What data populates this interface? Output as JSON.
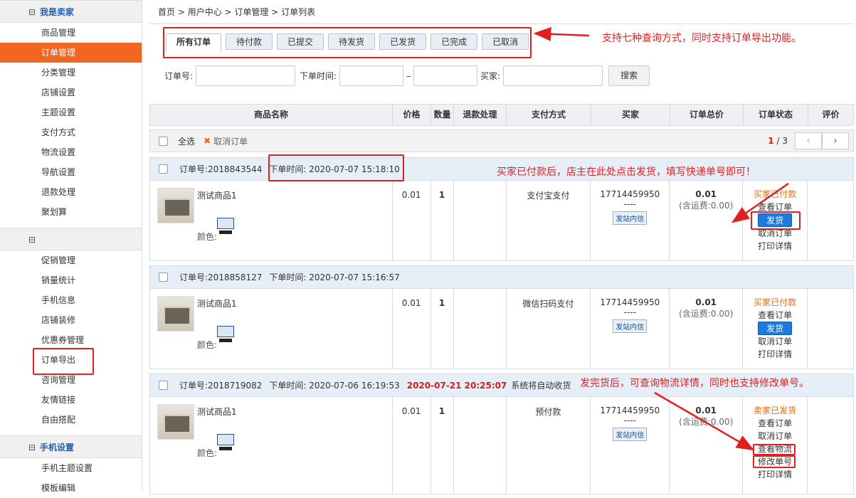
{
  "sidebar": {
    "section1": "我是卖家",
    "items1": [
      "商品管理",
      "订单管理",
      "分类管理",
      "店铺设置",
      "主题设置",
      "支付方式",
      "物流设置",
      "导航设置",
      "退款处理",
      "聚划算"
    ],
    "items2": [
      "促销管理",
      "销量统计",
      "手机信息",
      "店铺装修",
      "优惠券管理",
      "订单导出",
      "咨询管理",
      "友情链接",
      "自由搭配"
    ],
    "section3": "手机设置",
    "items3": [
      "手机主题设置",
      "模板编辑"
    ]
  },
  "breadcrumb": [
    "首页",
    "用户中心",
    "订单管理",
    "订单列表"
  ],
  "tabs": [
    "所有订单",
    "待付款",
    "已提交",
    "待发货",
    "已发货",
    "已完成",
    "已取消"
  ],
  "search": {
    "order_no_label": "订单号:",
    "time_label": "下单时间:",
    "dash": "–",
    "buyer_label": "买家:",
    "button": "搜索"
  },
  "columns": [
    "商品名称",
    "价格",
    "数量",
    "退款处理",
    "支付方式",
    "买家",
    "订单总价",
    "订单状态",
    "评价"
  ],
  "select_bar": {
    "select_all": "全选",
    "cancel_order": "取消订单",
    "page_current": "1",
    "page_sep": "/",
    "page_total": "3"
  },
  "orders": [
    {
      "no_label": "订单号:",
      "no": "2018843544",
      "time_label": "下单时间:",
      "time": "2020-07-07 15:18:10",
      "product": "测试商品1",
      "color_label": "颜色:",
      "price": "0.01",
      "qty": "1",
      "payment": "支付宝支付",
      "buyer": "17714459950",
      "buyer_sub": "----",
      "msg_btn": "发站内信",
      "total": "0.01",
      "freight": "(含运费:0.00)",
      "status": "买家已付款",
      "actions": [
        "查看订单",
        "发货",
        "取消订单",
        "打印详情"
      ]
    },
    {
      "no_label": "订单号:",
      "no": "2018858127",
      "time_label": "下单时间:",
      "time": "2020-07-07 15:16:57",
      "product": "测试商品1",
      "color_label": "颜色:",
      "price": "0.01",
      "qty": "1",
      "payment": "微信扫码支付",
      "buyer": "17714459950",
      "buyer_sub": "----",
      "msg_btn": "发站内信",
      "total": "0.01",
      "freight": "(含运费:0.00)",
      "status": "买家已付款",
      "actions": [
        "查看订单",
        "发货",
        "取消订单",
        "打印详情"
      ]
    },
    {
      "no_label": "订单号:",
      "no": "2018719082",
      "time_label": "下单时间:",
      "time": "2020-07-06 16:19:53",
      "auto_time": "2020-07-21 20:25:07",
      "auto_text": "系统将自动收货",
      "product": "测试商品1",
      "color_label": "颜色:",
      "price": "0.01",
      "qty": "1",
      "payment": "预付款",
      "buyer": "17714459950",
      "buyer_sub": "----",
      "msg_btn": "发站内信",
      "total": "0.01",
      "freight": "(含运费:0.00)",
      "status": "卖家已发货",
      "actions": [
        "查看订单",
        "取消订单",
        "查看物流",
        "修改单号",
        "打印详情"
      ]
    }
  ],
  "annotations": {
    "tabs_note": "支持七种查询方式，同时支持订单导出功能。",
    "ship_note": "买家已付款后，店主在此处点击发货，填写快递单号即可！",
    "shipped_note": "发完货后，可查询物流详情，同时也支持修改单号。"
  },
  "colors": {
    "active_menu": "#f26522",
    "annotation": "#e02020",
    "ship_button": "#1f7adf",
    "status_orange": "#e86b15"
  }
}
